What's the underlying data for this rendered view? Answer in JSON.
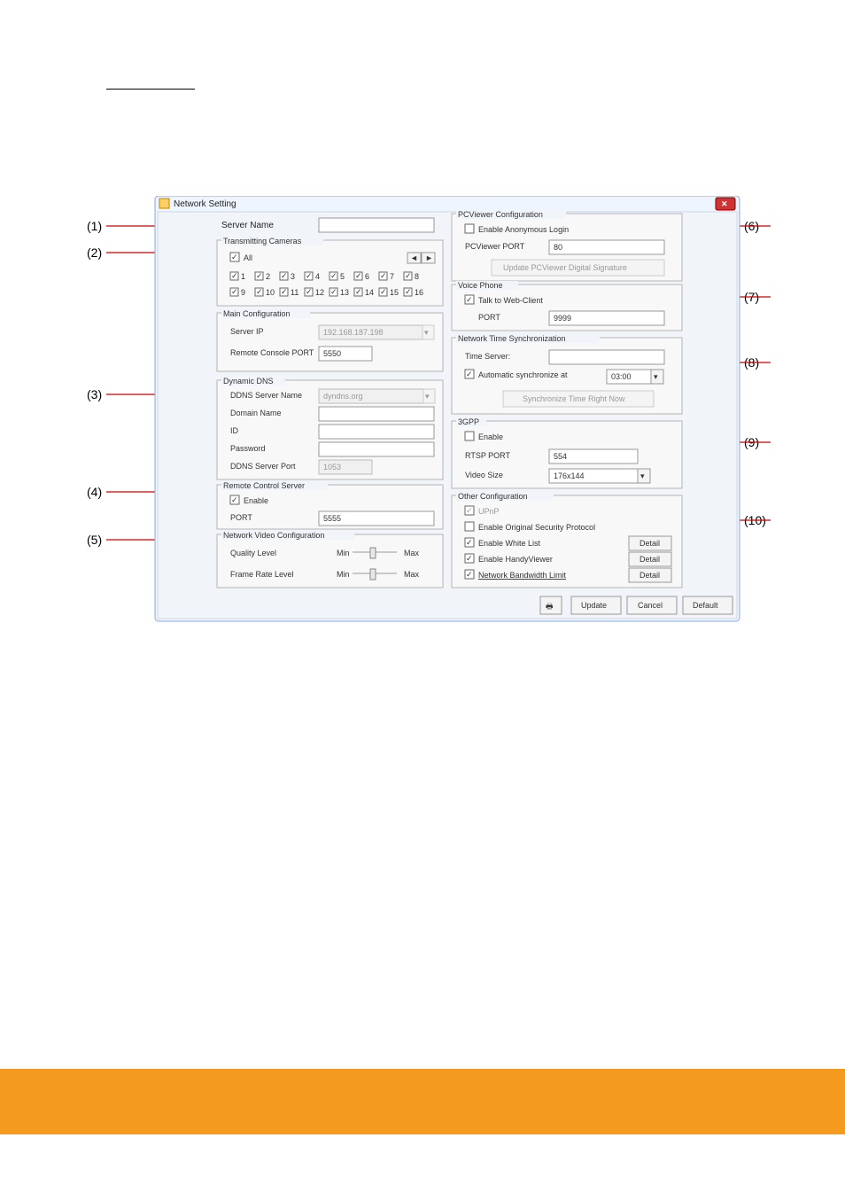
{
  "doc": {
    "link_placeholder_top": " ",
    "link_placeholder_mid": " "
  },
  "callouts": {
    "c1": "(1)",
    "c2": "(2)",
    "c3": "(3)",
    "c4": "(4)",
    "c5": "(5)",
    "c6": "(6)",
    "c7": "(7)",
    "c8": "(8)",
    "c9": "(9)",
    "c10": "(10)"
  },
  "win": {
    "title": "Network Setting"
  },
  "left": {
    "server_name_label": "Server Name",
    "transmitting_cameras": "Transmitting Cameras",
    "all_label": "All",
    "camera_row1": [
      "1",
      "2",
      "3",
      "4",
      "5",
      "6",
      "7",
      "8"
    ],
    "camera_row2": [
      "9",
      "10",
      "11",
      "12",
      "13",
      "14",
      "15",
      "16"
    ],
    "main_config": "Main Configuration",
    "server_ip_label": "Server IP",
    "server_ip_value": "192.168.187.198",
    "remote_console_label": "Remote Console PORT",
    "remote_console_value": "5550",
    "dynamic_dns": "Dynamic DNS",
    "ddns_server_name_label": "DDNS Server Name",
    "ddns_server_name_value": "dyndns.org",
    "domain_name_label": "Domain Name",
    "id_label": "ID",
    "password_label": "Password",
    "ddns_server_port_label": "DDNS Server Port",
    "ddns_server_port_value": "1053",
    "rcs": "Remote Control Server",
    "rcs_enable": "Enable",
    "rcs_port_label": "PORT",
    "rcs_port_value": "5555",
    "nvc": "Network Video Configuration",
    "quality_label": "Quality Level",
    "fr_label": "Frame Rate Level",
    "min": "Min",
    "max": "Max"
  },
  "right": {
    "pcv": "PCViewer Configuration",
    "anon_label": "Enable Anonymous Login",
    "pcv_port_label": "PCViewer PORT",
    "pcv_port_value": "80",
    "update_sig_btn": "Update PCViewer Digital Signature",
    "voice": "Voice Phone",
    "talk_label": "Talk to Web-Client",
    "voice_port_label": "PORT",
    "voice_port_value": "9999",
    "nts": "Network Time Synchronization",
    "time_server_label": "Time Server:",
    "auto_sync_label": "Automatic synchronize at",
    "auto_sync_value": "03:00",
    "sync_now_btn": "Synchronize Time Right Now",
    "g3gpp": "3GPP",
    "g3_enable": "Enable",
    "rtsp_label": "RTSP PORT",
    "rtsp_value": "554",
    "vsize_label": "Video Size",
    "vsize_value": "176x144",
    "other": "Other Configuration",
    "upnp_label": "UPnP",
    "osp_label": "Enable Original Security Protocol",
    "whitelist_label": "Enable White List",
    "handyviewer_label": "Enable HandyViewer",
    "nbl_label": "Network Bandwidth Limit",
    "detail_btn": "Detail"
  },
  "btns": {
    "update": "Update",
    "cancel": "Cancel",
    "default": "Default"
  }
}
